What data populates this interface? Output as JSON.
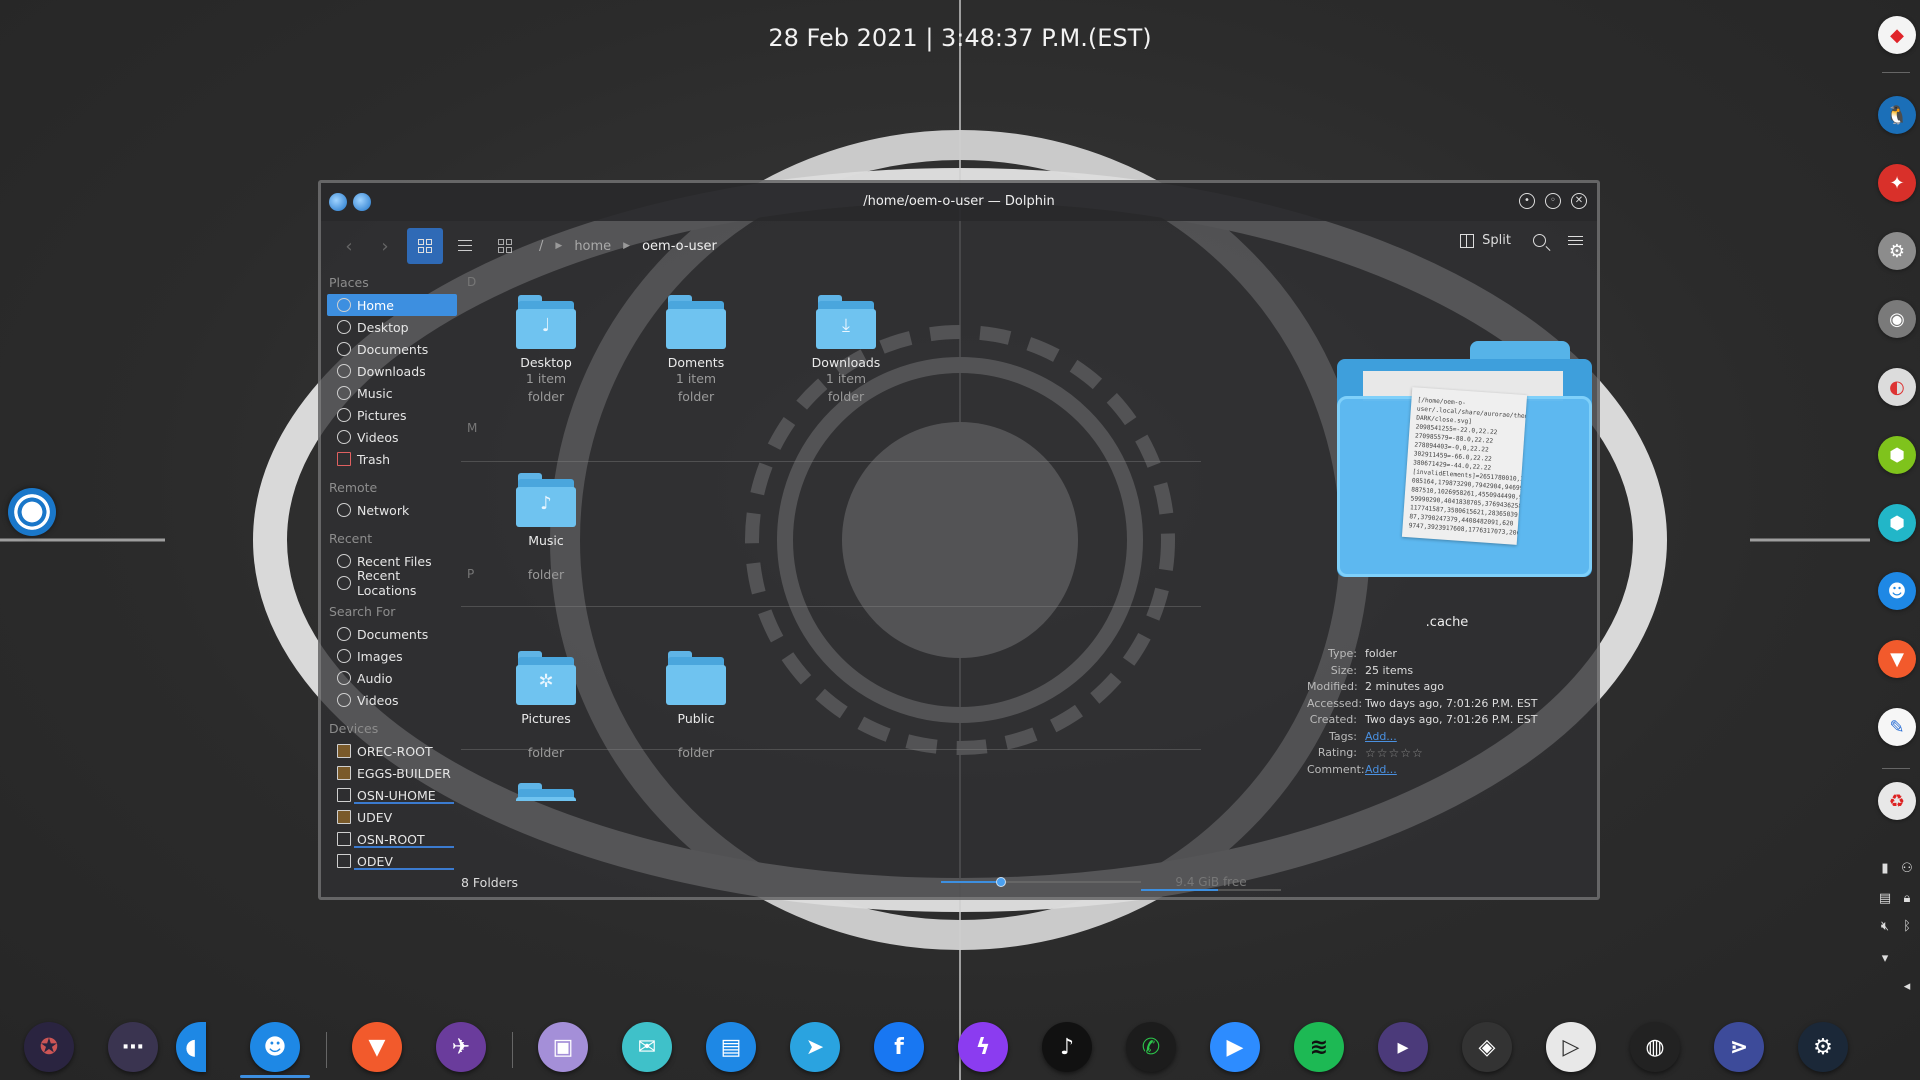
{
  "clock": "28 Feb 2021 | 3:48:37 P.M.(EST)",
  "window": {
    "title": "/home/oem-o-user — Dolphin"
  },
  "toolbar": {
    "breadcrumb": [
      "/",
      "home",
      "oem-o-user"
    ],
    "split_label": "Split"
  },
  "places": {
    "sections": [
      {
        "title": "Places",
        "items": [
          "Home",
          "Desktop",
          "Documents",
          "Downloads",
          "Music",
          "Pictures",
          "Videos",
          "Trash"
        ]
      },
      {
        "title": "Remote",
        "items": [
          "Network"
        ]
      },
      {
        "title": "Recent",
        "items": [
          "Recent Files",
          "Recent Locations"
        ]
      },
      {
        "title": "Search For",
        "items": [
          "Documents",
          "Images",
          "Audio",
          "Videos"
        ]
      },
      {
        "title": "Devices",
        "items": [
          "OREC-ROOT",
          "EGGS-BUILDER",
          "OSN-UHOME",
          "UDEV",
          "OSN-ROOT",
          "ODEV"
        ]
      }
    ]
  },
  "groups": [
    "D",
    "M",
    "P"
  ],
  "files": [
    {
      "name": "Desktop",
      "line1": "1 item",
      "line2": "folder",
      "emblem": "♩"
    },
    {
      "name": "Doments",
      "line1": "1 item",
      "line2": "folder",
      "emblem": ""
    },
    {
      "name": "Downloads",
      "line1": "1 item",
      "line2": "folder",
      "emblem": "⤓"
    },
    {
      "name": "Music",
      "line1": "",
      "line2": "folder",
      "emblem": "♪"
    },
    {
      "name": "Pictures",
      "line1": "",
      "line2": "folder",
      "emblem": "✲"
    },
    {
      "name": "Public",
      "line1": "",
      "line2": "folder",
      "emblem": ""
    }
  ],
  "preview": {
    "name": ".cache",
    "doc_text": "[/home/oem-o-user/.local/share/aurorae/themes/ROUNDED-DARK/close.svg]\n2098541255=-22.0,22.22\n270985579=-88.0,22.22\n278894403=-0,0,22.22\n302911459=-66.0,22.22\n380671429=-44.0,22.22\n[invalidElements]=2651780010,3597\n085164,179873290,7942904,9469961,5\n887510,1026958261,4550944490,95\n59990290,4041838705,3769436258,\n117741587,3580615621,28365039\n87,3790247379,4408482091,620\n9747,3923917608,1776317073,206",
    "meta": [
      {
        "key": "Type:",
        "val": "folder"
      },
      {
        "key": "Size:",
        "val": "25 items"
      },
      {
        "key": "Modified:",
        "val": "2 minutes ago"
      },
      {
        "key": "Accessed:",
        "val": "Two days ago, 7:01:26 P.M. EST"
      },
      {
        "key": "Created:",
        "val": "Two days ago, 7:01:26 P.M. EST"
      },
      {
        "key": "Tags:",
        "val": "Add..."
      },
      {
        "key": "Rating:",
        "val": "☆☆☆☆☆"
      },
      {
        "key": "Comment:",
        "val": "Add..."
      }
    ]
  },
  "status": {
    "count": "8 Folders",
    "free": "9.4 GiB free",
    "zoom_level": 0.3,
    "free_fill": 0.55
  }
}
